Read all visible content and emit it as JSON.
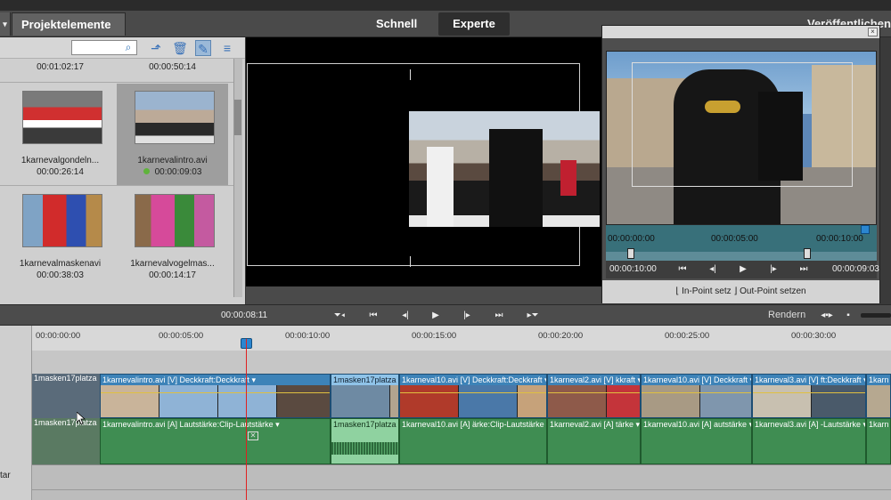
{
  "modebar": {
    "left_tab_label": "▾",
    "projekt_label": "Projektelemente ▾",
    "schnell": "Schnell",
    "experte": "Experte",
    "veroeffentlichen": "Veröffentlichen"
  },
  "project_panel": {
    "search_placeholder": "",
    "top_times": [
      "00:01:02:17",
      "00:00:50:14"
    ],
    "clips": [
      {
        "name": "1karnevalgondeln...",
        "duration": "00:00:26:14"
      },
      {
        "name": "1karnevalintro.avi",
        "duration": "00:00:09:03"
      },
      {
        "name": "1karnevalmaskenavi",
        "duration": "00:00:38:03"
      },
      {
        "name": "1karnevalvogelmas...",
        "duration": "00:00:14:17"
      }
    ]
  },
  "clip_monitor": {
    "close": "×",
    "scrub_start": "00:00:00:00",
    "scrub_mid": "00:00:05:00",
    "scrub_end": "00:00:10:00",
    "current_time": "00:00:10:00",
    "duration": "00:00:09:03",
    "in_point": "In-Point setz",
    "out_point": "Out-Point setzen",
    "playhead_fraction": 0.98
  },
  "transport": {
    "timecode": "00:00:08:11",
    "rendern": "Rendern"
  },
  "timeline": {
    "ticks": [
      "00:00:00:00",
      "00:00:05:00",
      "00:00:10:00",
      "00:00:15:00",
      "00:00:20:00",
      "00:00:25:00",
      "00:00:30:00"
    ],
    "track_v_head": "1masken17platza",
    "track_a_head": "1masken17platza",
    "left_label": "tar",
    "video_clips": [
      {
        "label": "1karnevalintro.avi [V]  Deckkraft:Deckkraft ▾",
        "selected": false
      },
      {
        "label": "1masken17platza",
        "selected": true
      },
      {
        "label": "1karneval10.avi [V]  Deckkraft:Deckkraft ▾",
        "selected": false
      },
      {
        "label": "1karneval2.avi [V]  kkraft ▾",
        "selected": false
      },
      {
        "label": "1karneval10.avi [V]  Deckkraft ▾",
        "selected": false
      },
      {
        "label": "1karneval3.avi [V]  ft:Deckkraft ▾",
        "selected": false
      },
      {
        "label": "1karn",
        "selected": false
      }
    ],
    "audio_clips": [
      {
        "label": "1karnevalintro.avi [A]  Lautstärke:Clip-Lautstärke ▾",
        "selected": false
      },
      {
        "label": "1masken17platza",
        "selected": true
      },
      {
        "label": "1karneval10.avi [A]  ärke:Clip-Lautstärke ▾",
        "selected": false
      },
      {
        "label": "1karneval2.avi [A]  tärke ▾",
        "selected": false
      },
      {
        "label": "1karneval10.avi [A]  autstärke ▾",
        "selected": false
      },
      {
        "label": "1karneval3.avi [A]  -Lautstärke ▾",
        "selected": false
      },
      {
        "label": "1karn",
        "selected": false
      }
    ]
  },
  "colors": {
    "accent": "#2b86d0",
    "playhead": "#e02020",
    "video_clip": "#3d83b8",
    "audio_clip": "#3f8d52"
  }
}
